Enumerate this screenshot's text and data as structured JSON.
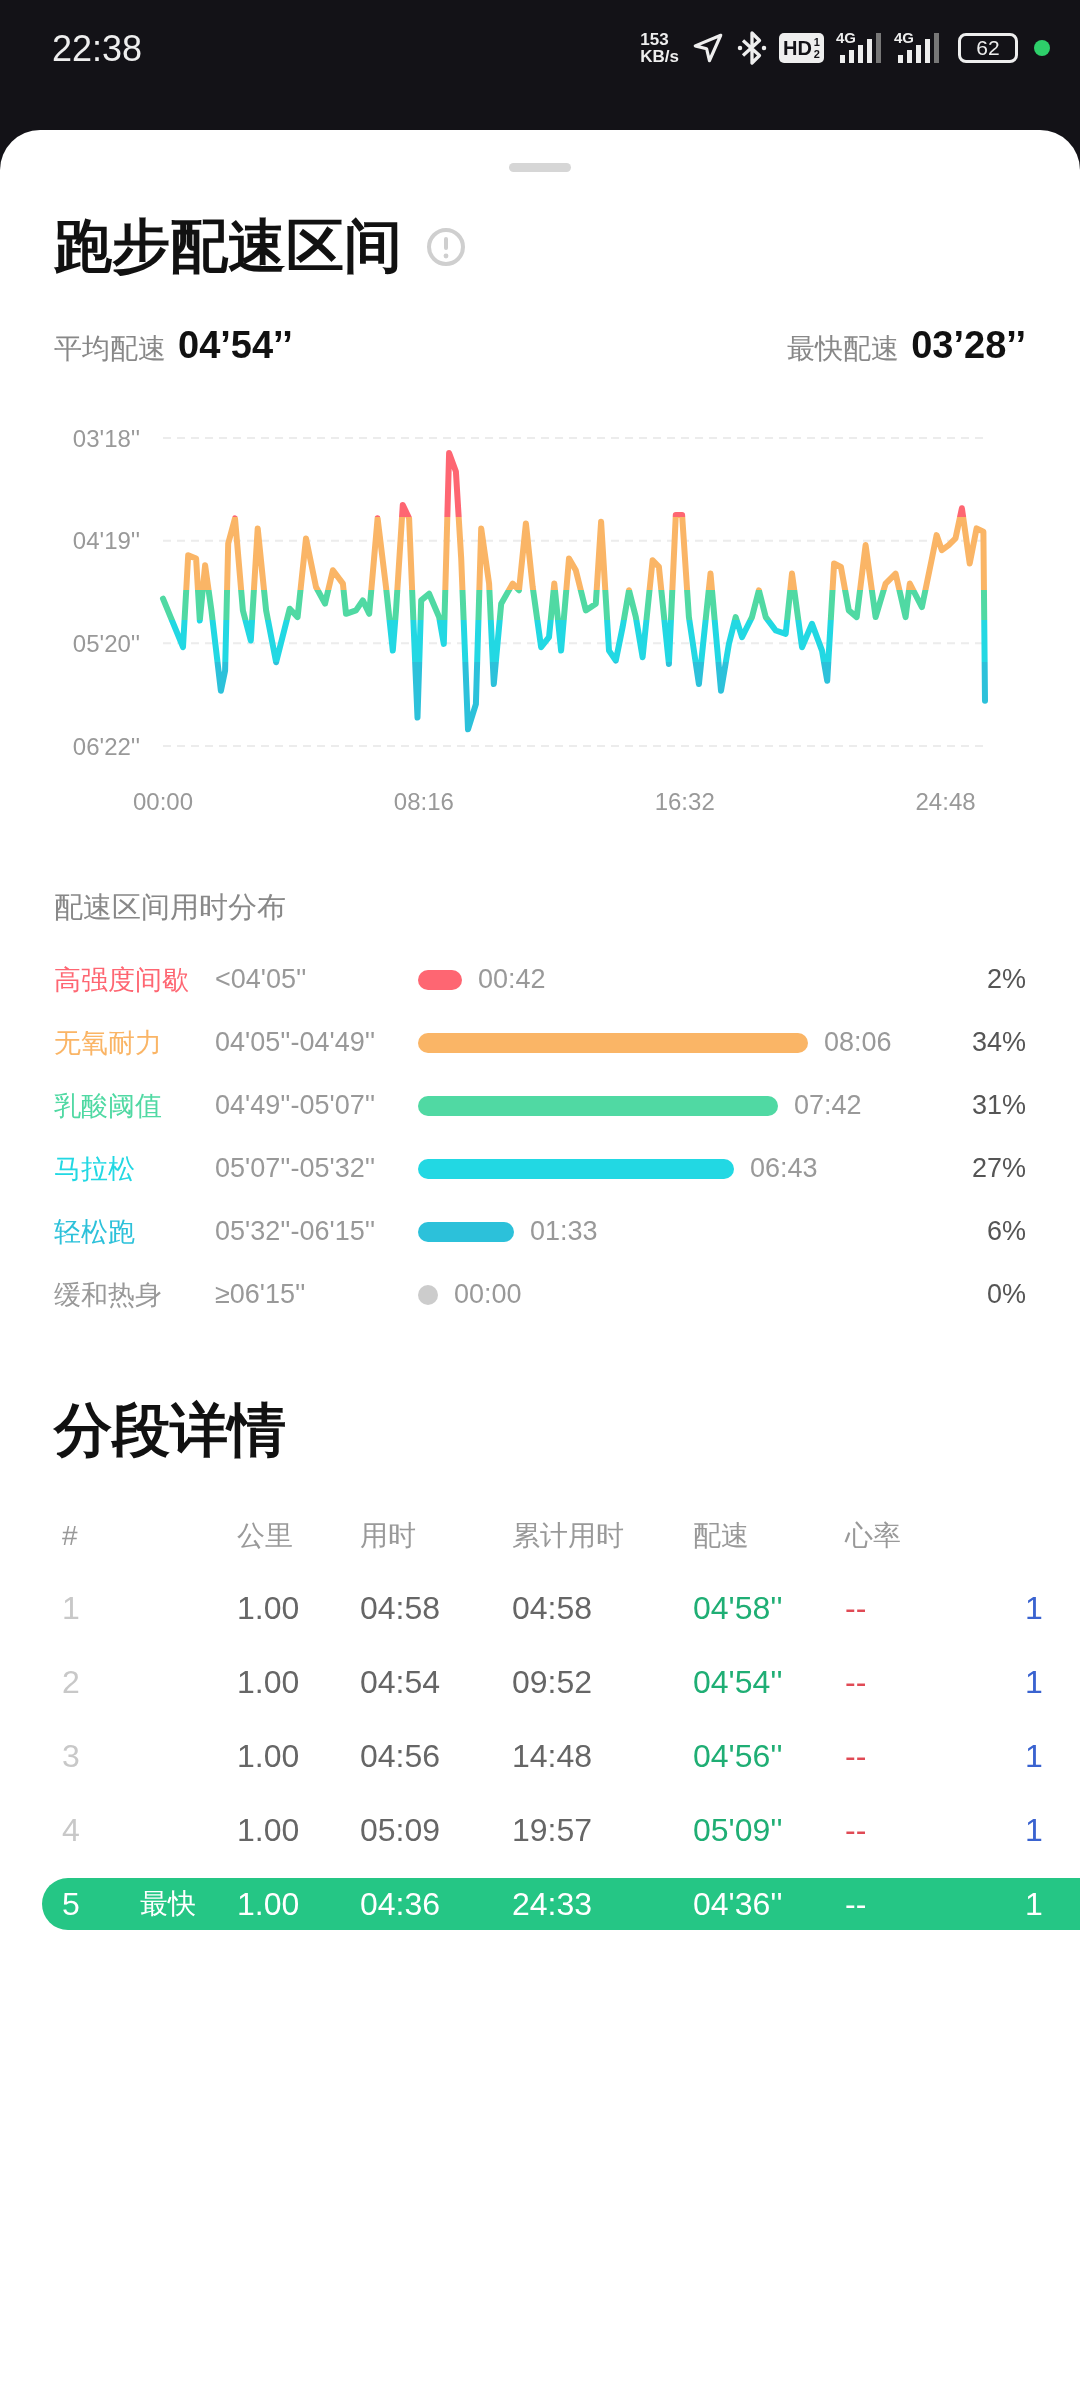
{
  "status_bar": {
    "time": "22:38",
    "speed_value": "153",
    "speed_unit": "KB/s",
    "hd_label": "HD",
    "hd_sup": "1",
    "hd_sub": "2",
    "network_1": "4G",
    "network_2": "4G",
    "battery": "62"
  },
  "pace_zones": {
    "title": "跑步配速区间",
    "average": {
      "label": "平均配速",
      "value": "04’54’’"
    },
    "fastest": {
      "label": "最快配速",
      "value": "03’28’’"
    },
    "chart": {
      "y_labels": [
        "03'18''",
        "04'19''",
        "05'20''",
        "06'22''"
      ],
      "x_labels": [
        "00:00",
        "08:16",
        "16:32",
        "24:48"
      ]
    },
    "distribution_title": "配速区间用时分布",
    "zones": [
      {
        "name": "高强度间歇",
        "range": "<04'05''",
        "duration": "00:42",
        "percent": "2%",
        "color": "#fe6672"
      },
      {
        "name": "无氧耐力",
        "range": "04'05''-04'49''",
        "duration": "08:06",
        "percent": "34%",
        "color": "#fab566"
      },
      {
        "name": "乳酸阈值",
        "range": "04'49''-05'07''",
        "duration": "07:42",
        "percent": "31%",
        "color": "#50d9a3"
      },
      {
        "name": "马拉松",
        "range": "05'07''-05'32''",
        "duration": "06:43",
        "percent": "27%",
        "color": "#22d8e3"
      },
      {
        "name": "轻松跑",
        "range": "05'32''-06'15''",
        "duration": "01:33",
        "percent": "6%",
        "color": "#2cc1da"
      },
      {
        "name": "缓和热身",
        "range": "≥06'15''",
        "duration": "00:00",
        "percent": "0%",
        "color": "#cccccc"
      }
    ]
  },
  "splits": {
    "title": "分段详情",
    "columns": [
      "#",
      "公里",
      "用时",
      "累计用时",
      "配速",
      "心率"
    ],
    "rows": [
      {
        "index": "1",
        "km": "1.00",
        "time": "04:58",
        "cumulative": "04:58",
        "pace": "04'58''",
        "heart_rate": "--",
        "column_7": "1",
        "fastest": false
      },
      {
        "index": "2",
        "km": "1.00",
        "time": "04:54",
        "cumulative": "09:52",
        "pace": "04'54''",
        "heart_rate": "--",
        "column_7": "1",
        "fastest": false
      },
      {
        "index": "3",
        "km": "1.00",
        "time": "04:56",
        "cumulative": "14:48",
        "pace": "04'56''",
        "heart_rate": "--",
        "column_7": "1",
        "fastest": false
      },
      {
        "index": "4",
        "km": "1.00",
        "time": "05:09",
        "cumulative": "19:57",
        "pace": "05'09''",
        "heart_rate": "--",
        "column_7": "1",
        "fastest": false
      },
      {
        "index": "5",
        "tag": "最快",
        "km": "1.00",
        "time": "04:36",
        "cumulative": "24:33",
        "pace": "04'36''",
        "heart_rate": "--",
        "column_7": "1",
        "fastest": true
      }
    ]
  }
}
